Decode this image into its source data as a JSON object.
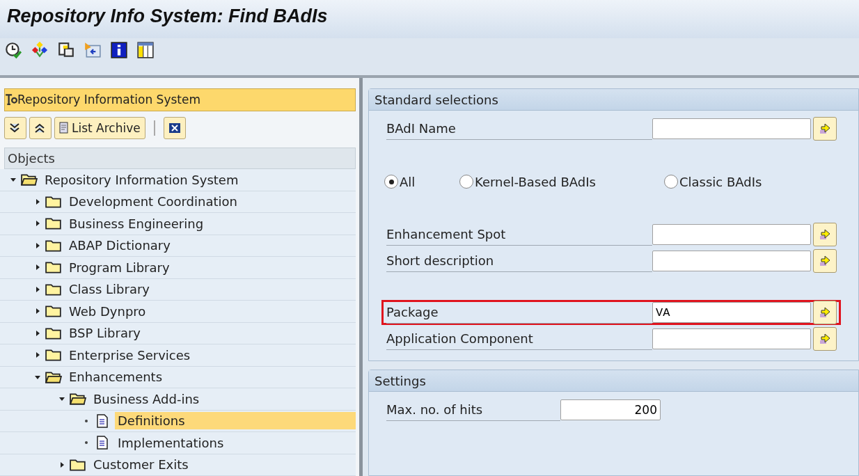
{
  "window": {
    "title": "Repository Info System: Find BAdIs"
  },
  "toolbar": {
    "icons": [
      {
        "kind": "execute"
      },
      {
        "kind": "hierarchy"
      },
      {
        "kind": "copy"
      },
      {
        "kind": "navigate"
      },
      {
        "kind": "info"
      },
      {
        "kind": "layout"
      }
    ]
  },
  "navigation": {
    "header": "Repository Information System",
    "buttons": [
      {
        "kind": "expand"
      },
      {
        "kind": "collapse"
      },
      {
        "kind": "archive",
        "label": "List Archive"
      },
      {
        "kind": "close"
      }
    ],
    "objects_header": "Objects",
    "tree": [
      {
        "label": "Repository Information System",
        "expanded": true,
        "selected": false,
        "children": [
          {
            "label": "Development Coordination",
            "expanded": false,
            "selected": false
          },
          {
            "label": "Business Engineering",
            "expanded": false,
            "selected": false
          },
          {
            "label": "ABAP Dictionary",
            "expanded": false,
            "selected": false
          },
          {
            "label": "Program Library",
            "expanded": false,
            "selected": false
          },
          {
            "label": "Class Library",
            "expanded": false,
            "selected": false
          },
          {
            "label": "Web Dynpro",
            "expanded": false,
            "selected": false
          },
          {
            "label": "BSP Library",
            "expanded": false,
            "selected": false
          },
          {
            "label": "Enterprise Services",
            "expanded": false,
            "selected": false
          },
          {
            "label": "Enhancements",
            "expanded": true,
            "selected": false,
            "children": [
              {
                "label": "Business Add-ins",
                "expanded": true,
                "selected": false,
                "children": [
                  {
                    "label": "Definitions",
                    "kind": "leaf",
                    "selected": true
                  },
                  {
                    "label": "Implementations",
                    "kind": "leaf",
                    "selected": false
                  }
                ]
              },
              {
                "label": "Customer Exits",
                "expanded": false,
                "selected": false
              }
            ]
          }
        ]
      }
    ]
  },
  "standard_selections": {
    "title": "Standard selections",
    "badi_name": {
      "label": "BAdI Name",
      "highlighted": false
    },
    "radios": [
      {
        "label": "All",
        "selected": true
      },
      {
        "label": "Kernel-Based BAdIs",
        "selected": false
      },
      {
        "label": "Classic BAdIs",
        "selected": false
      }
    ],
    "field_groups": [
      [
        {
          "label": "Enhancement Spot",
          "highlighted": false
        },
        {
          "label": "Short description",
          "highlighted": false
        }
      ],
      [
        {
          "label": "Package",
          "value": "VA",
          "highlighted": true
        },
        {
          "label": "Application Component",
          "highlighted": false
        }
      ]
    ]
  },
  "settings": {
    "title": "Settings",
    "max_hits": {
      "label": "Max. no. of hits",
      "value": "200"
    }
  }
}
